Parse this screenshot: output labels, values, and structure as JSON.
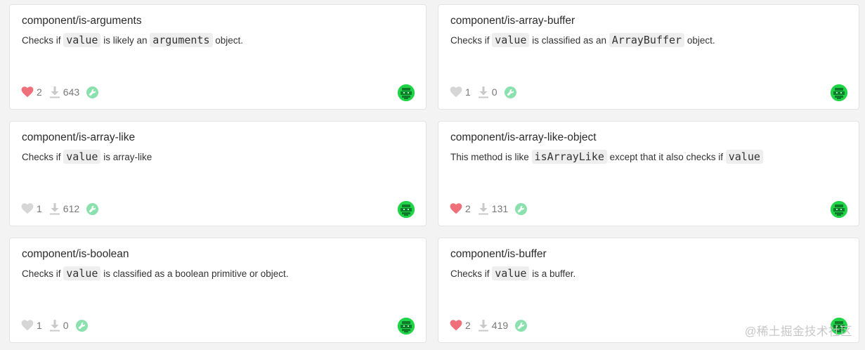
{
  "colors": {
    "heart_liked": "#f0707a",
    "heart_unliked": "#d6d6d6",
    "tool_badge": "#8be1ae",
    "avatar": "#1fd446"
  },
  "cards": [
    {
      "title": "component/is-arguments",
      "desc": [
        {
          "t": "text",
          "v": "Checks if "
        },
        {
          "t": "code",
          "v": "value"
        },
        {
          "t": "text",
          "v": " is likely an "
        },
        {
          "t": "code",
          "v": "arguments"
        },
        {
          "t": "text",
          "v": " object."
        }
      ],
      "likes": "2",
      "liked": true,
      "downloads": "643"
    },
    {
      "title": "component/is-array-buffer",
      "desc": [
        {
          "t": "text",
          "v": "Checks if "
        },
        {
          "t": "code",
          "v": "value"
        },
        {
          "t": "text",
          "v": " is classified as an "
        },
        {
          "t": "code",
          "v": "ArrayBuffer"
        },
        {
          "t": "text",
          "v": " object."
        }
      ],
      "likes": "1",
      "liked": false,
      "downloads": "0"
    },
    {
      "title": "component/is-array-like",
      "desc": [
        {
          "t": "text",
          "v": "Checks if "
        },
        {
          "t": "code",
          "v": "value"
        },
        {
          "t": "text",
          "v": " is array-like"
        }
      ],
      "likes": "1",
      "liked": false,
      "downloads": "612"
    },
    {
      "title": "component/is-array-like-object",
      "desc": [
        {
          "t": "text",
          "v": "This method is like "
        },
        {
          "t": "code",
          "v": "isArrayLike"
        },
        {
          "t": "text",
          "v": " except that it also checks if "
        },
        {
          "t": "code",
          "v": "value"
        }
      ],
      "likes": "2",
      "liked": true,
      "downloads": "131"
    },
    {
      "title": "component/is-boolean",
      "desc": [
        {
          "t": "text",
          "v": "Checks if "
        },
        {
          "t": "code",
          "v": "value"
        },
        {
          "t": "text",
          "v": " is classified as a boolean primitive or object."
        }
      ],
      "likes": "1",
      "liked": false,
      "downloads": "0"
    },
    {
      "title": "component/is-buffer",
      "desc": [
        {
          "t": "text",
          "v": "Checks if "
        },
        {
          "t": "code",
          "v": "value"
        },
        {
          "t": "text",
          "v": " is a buffer."
        }
      ],
      "likes": "2",
      "liked": true,
      "downloads": "419"
    }
  ],
  "icons": {
    "like": "heart-icon",
    "download": "download-icon",
    "tool": "wrench-icon",
    "avatar": "avatar-icon"
  },
  "watermark": "@稀土掘金技术社区"
}
